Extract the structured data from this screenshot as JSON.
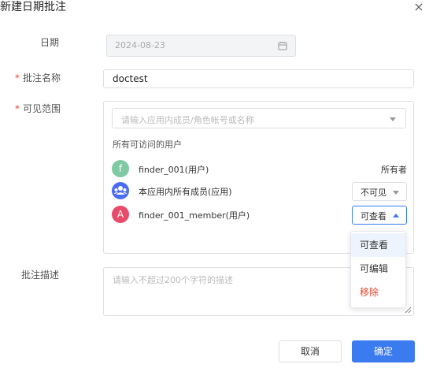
{
  "dialog": {
    "title": "新建日期批注",
    "close_icon": "close-icon"
  },
  "form": {
    "date": {
      "label": "日期",
      "value": "2024-08-23",
      "icon": "calendar-icon"
    },
    "name": {
      "required_mark": "*",
      "label": "批注名称",
      "value": "doctest"
    },
    "scope": {
      "required_mark": "*",
      "label": "可见范围",
      "select_placeholder": "请输入应用内成员/角色帐号或名称",
      "section_caption": "所有可访问的用户",
      "members": [
        {
          "avatar_text": "f",
          "avatar_color": "#7ec9a3",
          "name": "finder_001(用户)",
          "permission": "所有者"
        },
        {
          "avatar_icon": "group-icon",
          "avatar_color": "#4a6df0",
          "name": "本应用内所有成员(应用)",
          "permission": "不可见"
        },
        {
          "avatar_text": "A",
          "avatar_color": "#e94c6a",
          "name": "finder_001_member(用户)",
          "permission": "可查看"
        }
      ]
    },
    "description": {
      "label": "批注描述",
      "placeholder": "请输入不超过200个字符的描述"
    }
  },
  "permission_dropdown": {
    "options": [
      "可查看",
      "可编辑",
      "移除"
    ],
    "selected": "可查看"
  },
  "footer": {
    "cancel_label": "取消",
    "ok_label": "确定"
  },
  "colors": {
    "primary": "#3a7bef",
    "danger": "#e8452c",
    "border": "#dcdfe6"
  }
}
